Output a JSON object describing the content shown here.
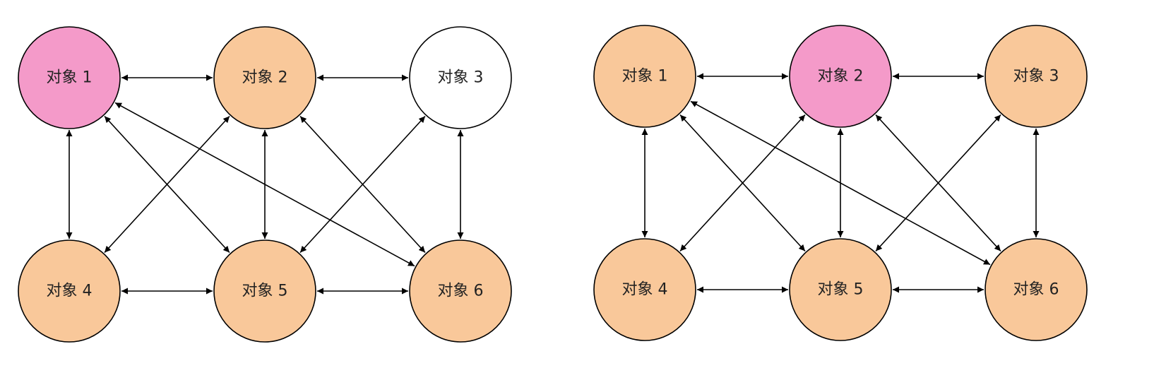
{
  "colors": {
    "highlight": "#f49ac9",
    "normal": "#f9c89a",
    "inactive": "#ffffff",
    "stroke": "#000000"
  },
  "diagrams": [
    {
      "nodes": [
        {
          "label": "对象 1",
          "state": "highlight"
        },
        {
          "label": "对象 2",
          "state": "normal"
        },
        {
          "label": "对象 3",
          "state": "inactive"
        },
        {
          "label": "对象 4",
          "state": "normal"
        },
        {
          "label": "对象 5",
          "state": "normal"
        },
        {
          "label": "对象 6",
          "state": "normal"
        }
      ],
      "edges": [
        [
          1,
          2
        ],
        [
          2,
          3
        ],
        [
          4,
          5
        ],
        [
          5,
          6
        ],
        [
          1,
          4
        ],
        [
          2,
          5
        ],
        [
          3,
          6
        ],
        [
          1,
          5
        ],
        [
          1,
          6
        ],
        [
          2,
          4
        ],
        [
          2,
          6
        ],
        [
          3,
          5
        ]
      ]
    },
    {
      "nodes": [
        {
          "label": "对象 1",
          "state": "normal"
        },
        {
          "label": "对象 2",
          "state": "highlight"
        },
        {
          "label": "对象 3",
          "state": "normal"
        },
        {
          "label": "对象 4",
          "state": "normal"
        },
        {
          "label": "对象 5",
          "state": "normal"
        },
        {
          "label": "对象 6",
          "state": "normal"
        }
      ],
      "edges": [
        [
          1,
          2
        ],
        [
          2,
          3
        ],
        [
          4,
          5
        ],
        [
          5,
          6
        ],
        [
          1,
          4
        ],
        [
          2,
          5
        ],
        [
          3,
          6
        ],
        [
          1,
          5
        ],
        [
          1,
          6
        ],
        [
          2,
          4
        ],
        [
          2,
          6
        ],
        [
          3,
          5
        ]
      ]
    }
  ]
}
